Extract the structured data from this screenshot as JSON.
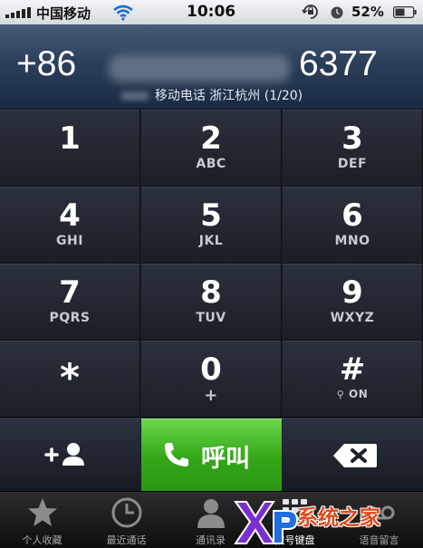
{
  "status_bar": {
    "carrier": "中国移动",
    "time": "10:06",
    "battery_percent": "52%"
  },
  "display": {
    "number_prefix": "+86",
    "number_suffix": "6377",
    "caller_location": "移动电话 浙江杭州 (1/20)"
  },
  "keypad": {
    "keys": [
      {
        "digit": "1",
        "letters": ""
      },
      {
        "digit": "2",
        "letters": "ABC"
      },
      {
        "digit": "3",
        "letters": "DEF"
      },
      {
        "digit": "4",
        "letters": "GHI"
      },
      {
        "digit": "5",
        "letters": "JKL"
      },
      {
        "digit": "6",
        "letters": "MNO"
      },
      {
        "digit": "7",
        "letters": "PQRS"
      },
      {
        "digit": "8",
        "letters": "TUV"
      },
      {
        "digit": "9",
        "letters": "WXYZ"
      },
      {
        "digit": "*",
        "letters": ""
      },
      {
        "digit": "0",
        "letters": "+"
      },
      {
        "digit": "#",
        "letters": "ON"
      }
    ]
  },
  "actions": {
    "call_label": "呼叫",
    "call_color": "#3db51f"
  },
  "tab_bar": {
    "tabs": [
      {
        "label": "个人收藏",
        "icon": "star-icon"
      },
      {
        "label": "最近通话",
        "icon": "clock-icon"
      },
      {
        "label": "通讯录",
        "icon": "contacts-icon"
      },
      {
        "label": "拨号键盘",
        "icon": "keypad-icon",
        "active": true
      },
      {
        "label": "语音留言",
        "icon": "voicemail-icon"
      }
    ]
  },
  "watermark": {
    "text": "系统之家",
    "logo_text": "XP"
  }
}
